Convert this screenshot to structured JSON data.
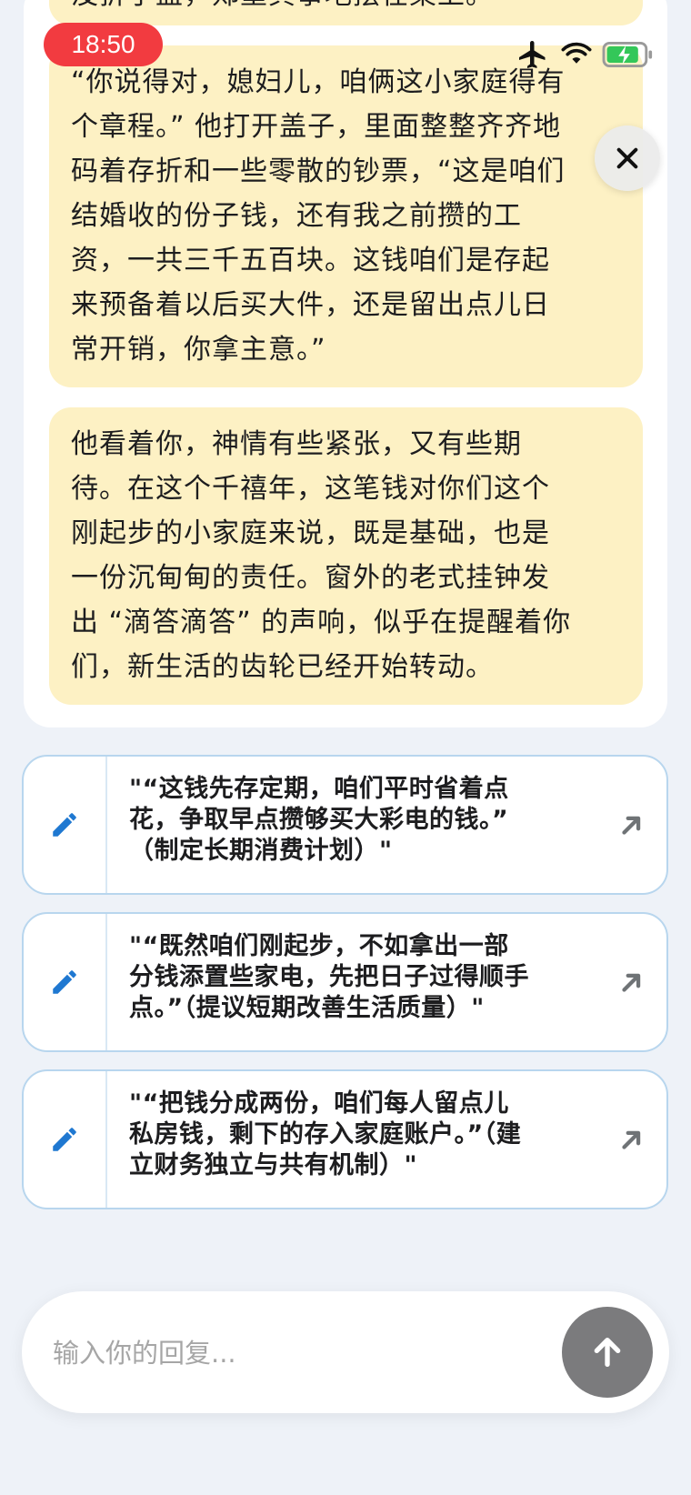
{
  "status": {
    "time": "18:50",
    "icons": [
      "airplane-icon",
      "wifi-icon",
      "battery-charging-icon"
    ],
    "time_bg_color": "#f23b40"
  },
  "story": {
    "paragraphs": [
      "没折子盖，郑重其事地摆在桌上。",
      "“你说得对，媳妇儿，咱俩这小家庭得有\n个章程。” 他打开盖子，里面整整齐齐地\n码着存折和一些零散的钞票，“这是咱们\n结婚收的份子钱，还有我之前攒的工\n资，一共三千五百块。这钱咱们是存起\n来预备着以后买大件，还是留出点儿日\n常开销，你拿主意。”",
      "他看着你，神情有些紧张，又有些期\n待。在这个千禧年，这笔钱对你们这个\n刚起步的小家庭来说，既是基础，也是\n一份沉甸甸的责任。窗外的老式挂钟发\n出 “滴答滴答” 的声响，似乎在提醒着你\n们，新生活的齿轮已经开始转动。"
    ],
    "bubble_color": "#fdf1c4"
  },
  "options": [
    {
      "text": "\"“这钱先存定期，咱们平时省着点\n花，争取早点攒够买大彩电的钱。”\n（制定长期消费计划）\""
    },
    {
      "text": "\"“既然咱们刚起步，不如拿出一部\n分钱添置些家电，先把日子过得顺手\n点。”（提议短期改善生活质量）\""
    },
    {
      "text": "\"“把钱分成两份，咱们每人留点儿\n私房钱，剩下的存入家庭账户。”（建\n立财务独立与共有机制）\""
    }
  ],
  "reply": {
    "placeholder": "输入你的回复...",
    "value": ""
  },
  "colors": {
    "accent": "#1f78d1",
    "option_border": "#b8d6ee",
    "send_button": "#7b7b7d",
    "background": "#eef2f8"
  }
}
